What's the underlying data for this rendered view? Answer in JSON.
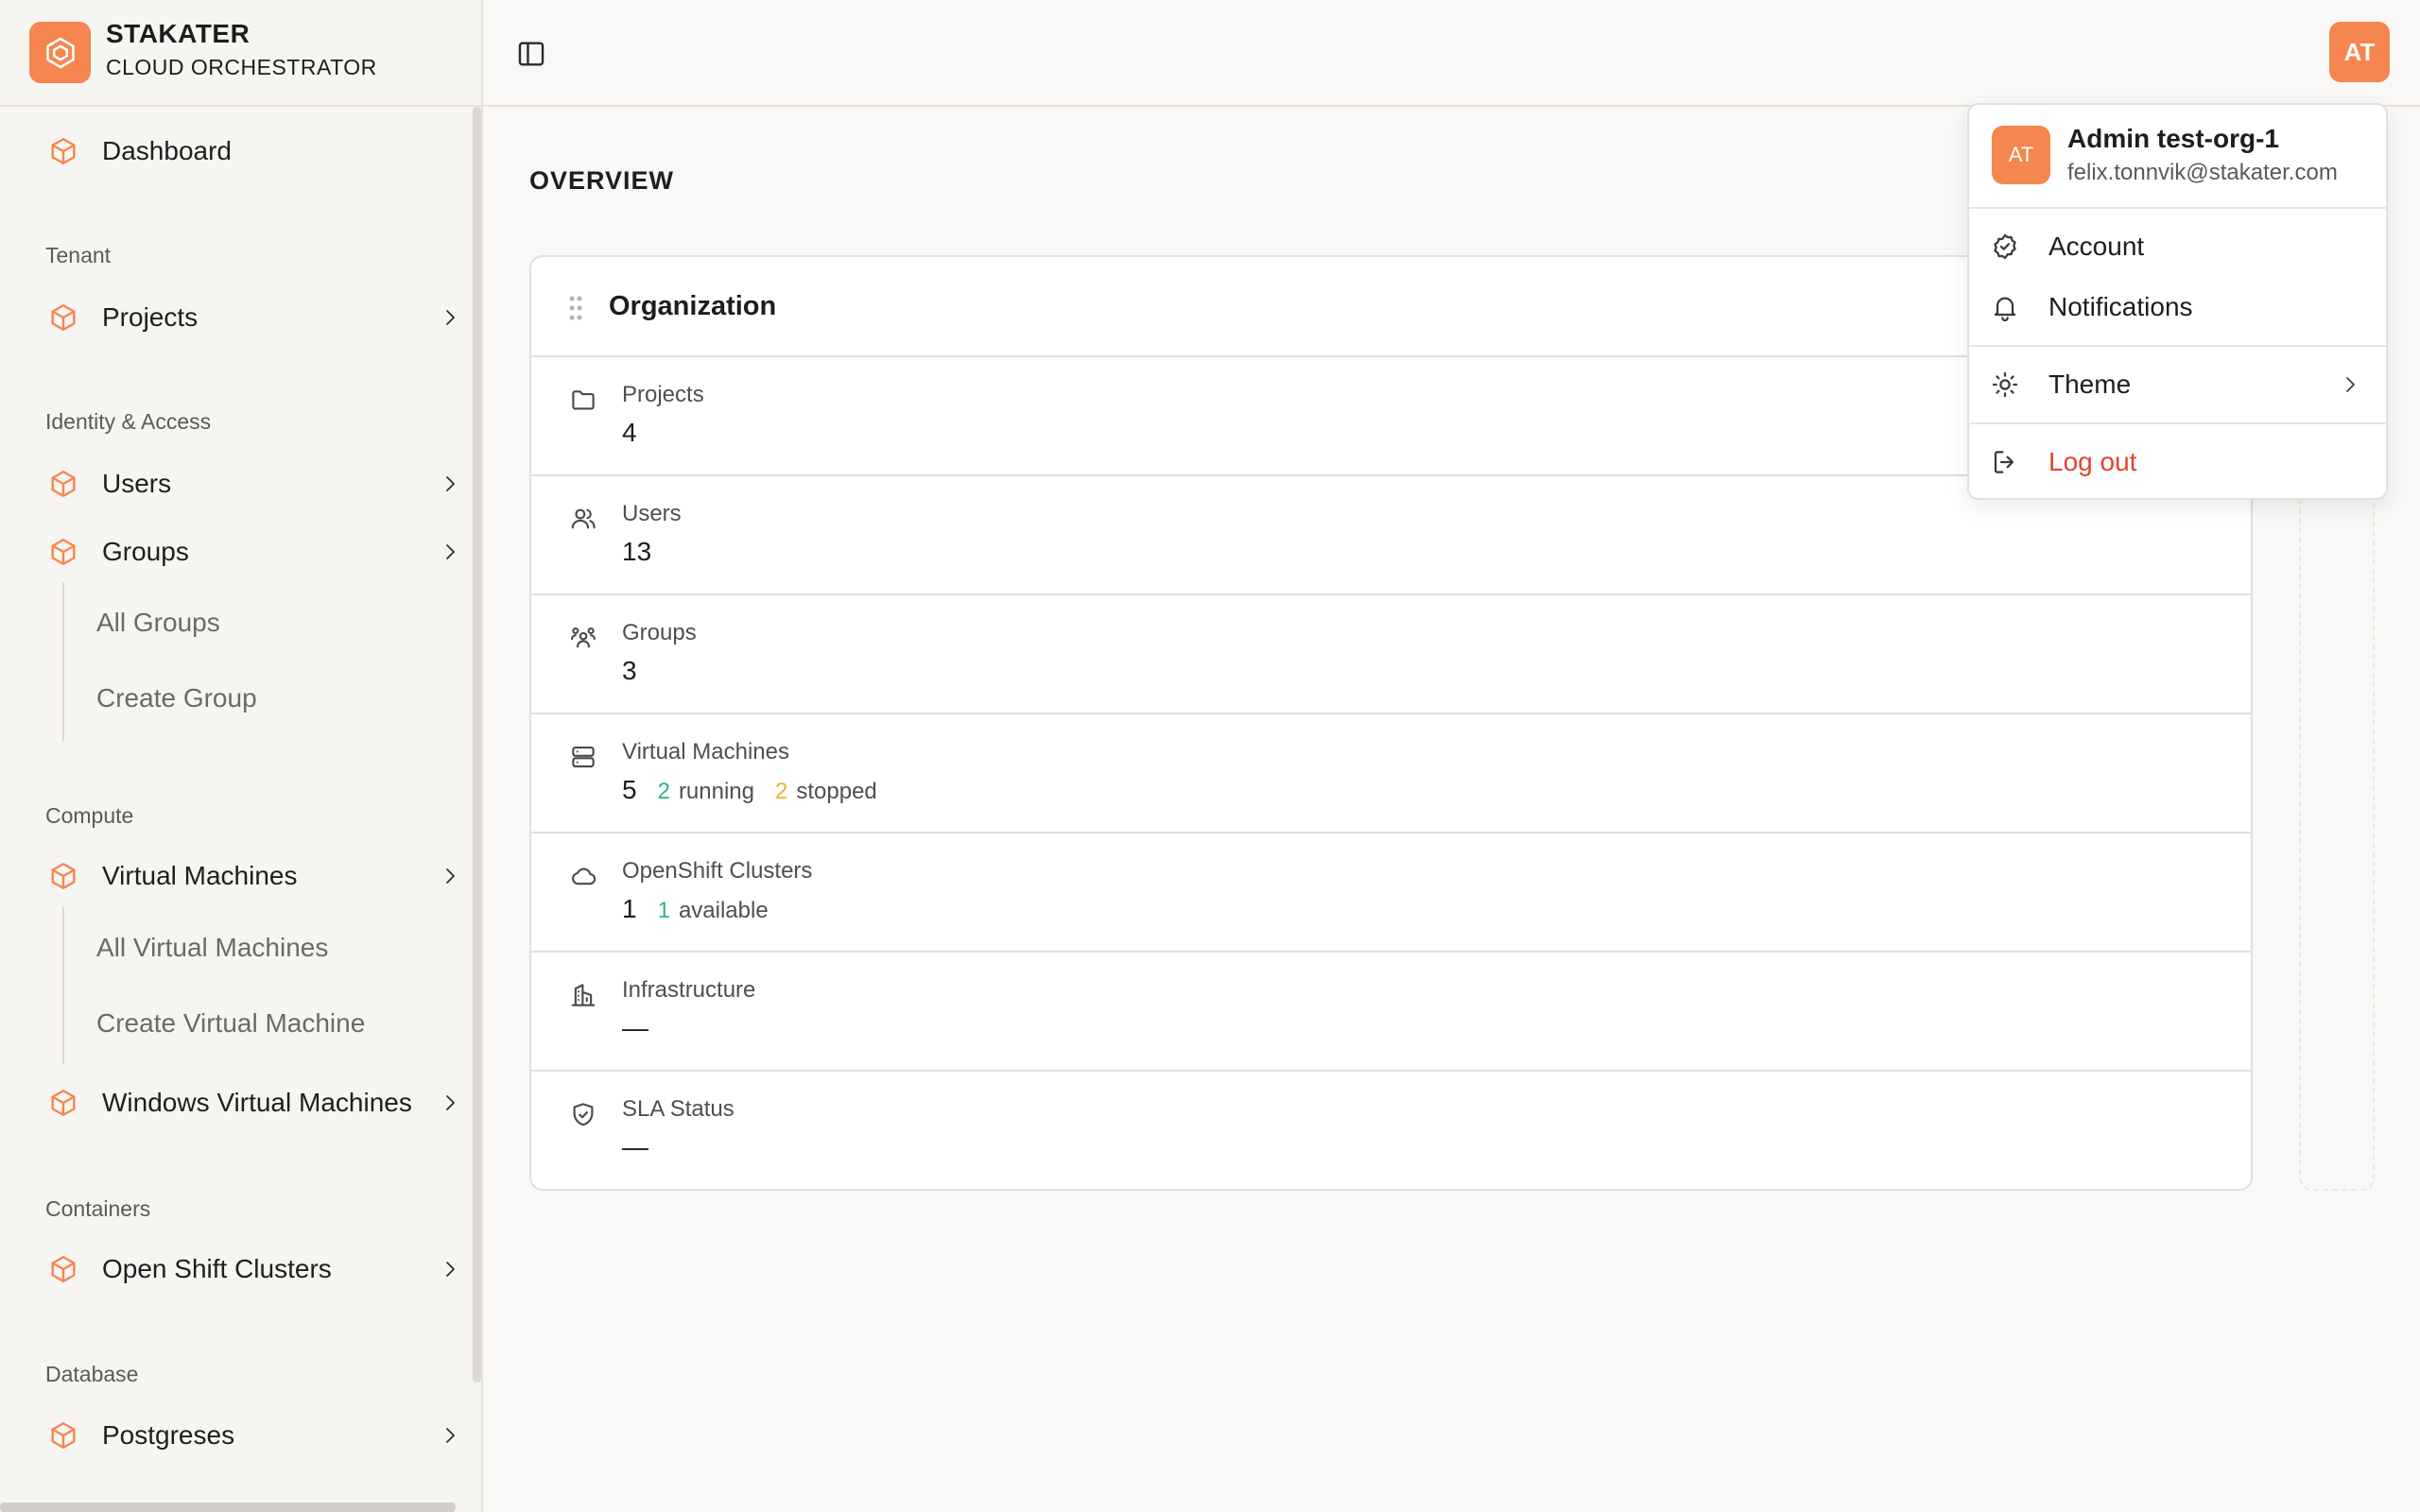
{
  "brand": {
    "name": "STAKATER",
    "subtitle": "CLOUD ORCHESTRATOR"
  },
  "sidebar": {
    "dashboard": "Dashboard",
    "sections": {
      "tenant": "Tenant",
      "identity": "Identity & Access",
      "compute": "Compute",
      "containers": "Containers",
      "database": "Database"
    },
    "items": {
      "projects": "Projects",
      "users": "Users",
      "groups": "Groups",
      "all_groups": "All Groups",
      "create_group": "Create Group",
      "virtual_machines": "Virtual Machines",
      "all_vms": "All Virtual Machines",
      "create_vm": "Create Virtual Machine",
      "windows_vms": "Windows Virtual Machines",
      "openshift": "Open Shift Clusters",
      "postgreses": "Postgreses"
    }
  },
  "header": {
    "avatar_initials": "AT"
  },
  "main": {
    "title": "OVERVIEW",
    "card_title": "Organization",
    "rows": {
      "projects": {
        "label": "Projects",
        "value": "4"
      },
      "users": {
        "label": "Users",
        "value": "13"
      },
      "groups": {
        "label": "Groups",
        "value": "3"
      },
      "vms": {
        "label": "Virtual Machines",
        "value": "5",
        "running_count": "2",
        "running_label": "running",
        "stopped_count": "2",
        "stopped_label": "stopped"
      },
      "clusters": {
        "label": "OpenShift Clusters",
        "value": "1",
        "available_count": "1",
        "available_label": "available"
      },
      "infrastructure": {
        "label": "Infrastructure",
        "value": "—"
      },
      "sla": {
        "label": "SLA Status",
        "value": "—"
      }
    }
  },
  "dropdown": {
    "avatar_initials": "AT",
    "name": "Admin test-org-1",
    "email": "felix.tonnvik@stakater.com",
    "account": "Account",
    "notifications": "Notifications",
    "theme": "Theme",
    "logout": "Log out"
  },
  "colors": {
    "accent": "#f5864f",
    "running": "#2fb488",
    "stopped": "#f0b429",
    "danger": "#e0452f"
  }
}
